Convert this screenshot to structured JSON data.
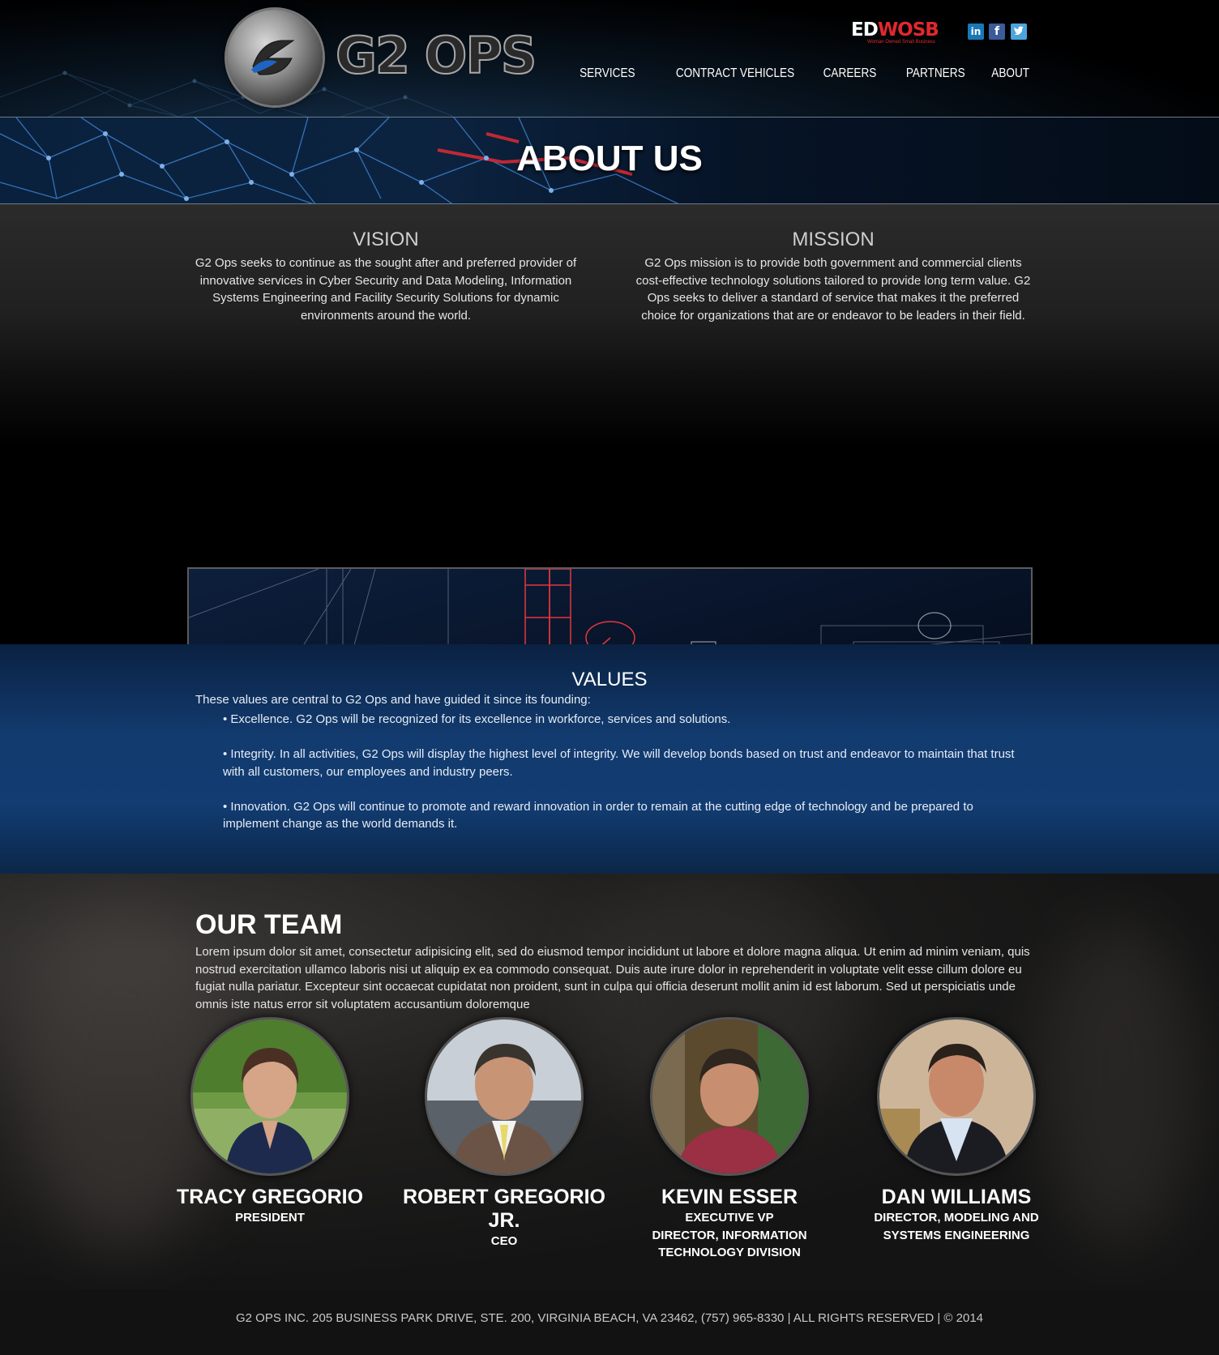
{
  "brand": {
    "logo_text": "G2 OPS",
    "badge_main_left": "ED",
    "badge_main_right": "WOSB",
    "badge_sub": "Woman Owned Small Business"
  },
  "social": {
    "linkedin": "in",
    "facebook": "f",
    "twitter": "t"
  },
  "nav": {
    "items": [
      "SERVICES",
      "CONTRACT VEHICLES",
      "CAREERS",
      "PARTNERS",
      "ABOUT"
    ]
  },
  "hero": {
    "title": "ABOUT US"
  },
  "vision": {
    "title": "VISION",
    "text": "G2 Ops seeks to continue as the sought after and preferred provider of innovative services in Cyber Security and Data Modeling, Information Systems Engineering and Facility Security Solutions for dynamic environments around the world."
  },
  "mission": {
    "title": "MISSION",
    "text": "G2 Ops mission is to provide both government and commercial clients cost-effective technology solutions tailored to provide long term value. G2 Ops seeks to deliver a standard of service that makes it the preferred choice for organizations that are or endeavor to be leaders in their field."
  },
  "values": {
    "title": "VALUES",
    "intro": "These values are central to G2 Ops and have guided it since its founding:",
    "items": [
      "Excellence. G2 Ops will be recognized for its excellence in workforce, services and solutions.",
      "Integrity. In all activities, G2 Ops will display the highest level of integrity. We will develop bonds based on trust and endeavor to maintain that trust with all customers, our employees and industry peers.",
      "Innovation. G2 Ops will continue to promote and reward innovation in order to remain at the cutting edge of technology and be prepared to implement change as the world demands it."
    ]
  },
  "team": {
    "title": "OUR TEAM",
    "text": "Lorem ipsum dolor sit amet, consectetur adipisicing elit, sed do eiusmod tempor incididunt ut labore et dolore magna aliqua. Ut enim ad minim veniam, quis nostrud exercitation ullamco laboris nisi ut aliquip ex ea commodo consequat. Duis aute irure dolor in reprehenderit in voluptate velit esse cillum dolore eu fugiat nulla pariatur. Excepteur sint occaecat cupidatat non proident, sunt in culpa qui officia deserunt mollit anim id est laborum. Sed ut perspiciatis unde omnis iste natus error sit voluptatem accusantium doloremque",
    "members": [
      {
        "name": "TRACY GREGORIO",
        "title": "PRESIDENT"
      },
      {
        "name": "ROBERT GREGORIO JR.",
        "title": "CEO"
      },
      {
        "name": "KEVIN ESSER",
        "title": "EXECUTIVE VP\nDIRECTOR, INFORMATION\nTECHNOLOGY DIVISION"
      },
      {
        "name": "DAN WILLIAMS",
        "title": "DIRECTOR, MODELING AND\nSYSTEMS ENGINEERING"
      }
    ]
  },
  "footer": {
    "text": "G2 OPS INC. 205 BUSINESS PARK DRIVE, STE. 200, VIRGINIA BEACH, VA 23462, (757) 965-8330 | ALL RIGHTS RESERVED | © 2014"
  },
  "colors": {
    "accent_red": "#e0282e",
    "values_blue": "#123c72",
    "nav_text": "#ffffff"
  }
}
